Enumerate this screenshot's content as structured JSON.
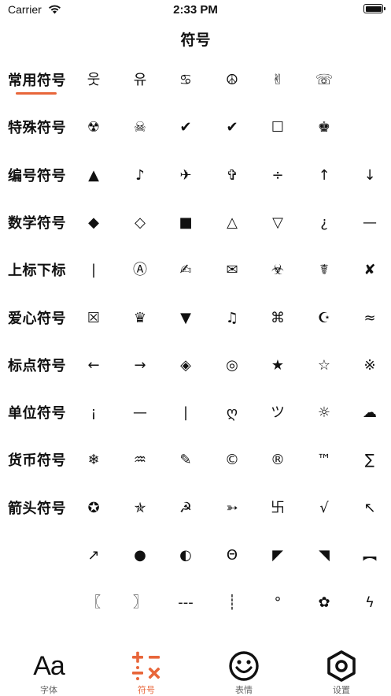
{
  "status": {
    "carrier": "Carrier",
    "time": "2:33 PM"
  },
  "nav": {
    "title": "符号"
  },
  "sidebar": {
    "active_index": 0,
    "items": [
      {
        "label": "常用符号"
      },
      {
        "label": "特殊符号"
      },
      {
        "label": "编号符号"
      },
      {
        "label": "数学符号"
      },
      {
        "label": "上标下标"
      },
      {
        "label": "爱心符号"
      },
      {
        "label": "标点符号"
      },
      {
        "label": "单位符号"
      },
      {
        "label": "货币符号"
      },
      {
        "label": "箭头符号"
      }
    ]
  },
  "grid": {
    "rows": [
      [
        "웃",
        "유",
        "♋",
        "☮",
        "✌",
        "☏"
      ],
      [
        "☢",
        "☠",
        "✔",
        "✔",
        "☐",
        "♚"
      ],
      [
        "▲",
        "♪",
        "✈",
        "✞",
        "÷",
        "↑",
        "↓"
      ],
      [
        "◆",
        "◇",
        "■",
        "△",
        "▽",
        "¿",
        "—"
      ],
      [
        "|",
        "Ⓐ",
        "✍",
        "✉",
        "☣",
        "☤",
        "✘"
      ],
      [
        "☒",
        "♛",
        "▼",
        "♫",
        "⌘",
        "☪",
        "≈"
      ],
      [
        "←",
        "→",
        "◈",
        "◎",
        "★",
        "☆",
        "※"
      ],
      [
        "¡",
        "—",
        "|",
        "ღ",
        "ツ",
        "☼",
        "☁"
      ],
      [
        "❄",
        "♒",
        "✎",
        "©",
        "®",
        "™",
        "∑"
      ],
      [
        "✪",
        "✯",
        "☭",
        "➳",
        "卐",
        "√",
        "↖"
      ],
      [
        "↗",
        "●",
        "◐",
        "Θ",
        "◤",
        "◥",
        "︻"
      ],
      [
        "〖",
        "〗",
        "---",
        "┊",
        "°",
        "✿",
        "ϟ"
      ]
    ]
  },
  "tabs": [
    {
      "label": "字体",
      "icon": "font-aa-icon"
    },
    {
      "label": "符号",
      "icon": "math-operators-icon"
    },
    {
      "label": "表情",
      "icon": "smiley-icon"
    },
    {
      "label": "设置",
      "icon": "settings-hex-icon"
    }
  ],
  "colors": {
    "accent": "#e8663a",
    "text": "#111111",
    "inactive": "#666666"
  }
}
